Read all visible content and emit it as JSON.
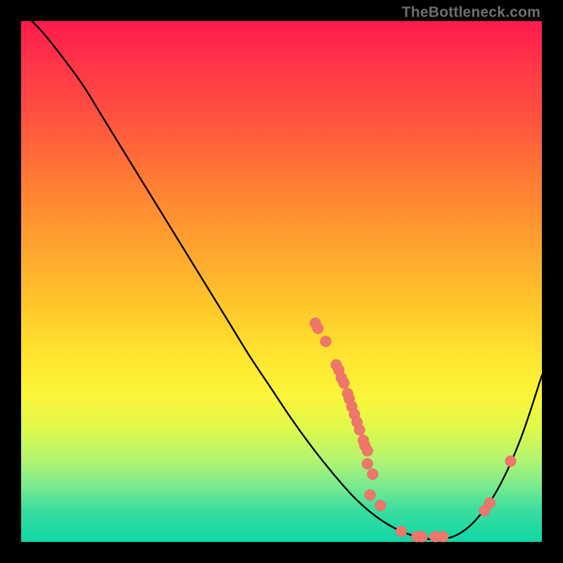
{
  "watermark": "TheBottleneck.com",
  "colors": {
    "dot": "#ee766b",
    "curve": "#000000"
  },
  "chart_data": {
    "type": "line",
    "title": "",
    "xlabel": "",
    "ylabel": "",
    "xlim": [
      0,
      100
    ],
    "ylim": [
      0,
      100
    ],
    "grid": false,
    "legend": false,
    "series": [
      {
        "name": "curve",
        "x": [
          0,
          4,
          8,
          12,
          16,
          20,
          24,
          28,
          32,
          36,
          40,
          44,
          48,
          52,
          56,
          60,
          64,
          68,
          72,
          76,
          80,
          84,
          88,
          92,
          96,
          100
        ],
        "y": [
          102,
          98,
          93,
          87.5,
          81,
          74.5,
          68,
          61.5,
          55,
          48.5,
          42,
          35.5,
          29.5,
          23.5,
          18,
          13,
          8.5,
          5,
          2.5,
          1,
          0.5,
          1.5,
          5,
          11,
          20,
          32
        ]
      }
    ],
    "points": [
      {
        "name": "p1",
        "x": 56.5,
        "y": 42.0
      },
      {
        "name": "p2",
        "x": 57.0,
        "y": 41.0
      },
      {
        "name": "p3",
        "x": 58.5,
        "y": 38.5
      },
      {
        "name": "p4",
        "x": 60.5,
        "y": 34.0
      },
      {
        "name": "p5",
        "x": 61.0,
        "y": 33.0
      },
      {
        "name": "p6",
        "x": 61.5,
        "y": 31.5
      },
      {
        "name": "p7",
        "x": 62.0,
        "y": 30.5
      },
      {
        "name": "p8",
        "x": 62.7,
        "y": 28.5
      },
      {
        "name": "p9",
        "x": 63.0,
        "y": 27.5
      },
      {
        "name": "p10",
        "x": 63.5,
        "y": 26.0
      },
      {
        "name": "p11",
        "x": 64.0,
        "y": 24.5
      },
      {
        "name": "p12",
        "x": 64.5,
        "y": 23.0
      },
      {
        "name": "p13",
        "x": 65.0,
        "y": 21.5
      },
      {
        "name": "p14",
        "x": 65.7,
        "y": 19.5
      },
      {
        "name": "p15",
        "x": 66.0,
        "y": 18.5
      },
      {
        "name": "p16",
        "x": 66.5,
        "y": 17.5
      },
      {
        "name": "p17",
        "x": 66.5,
        "y": 15.0
      },
      {
        "name": "p18",
        "x": 67.5,
        "y": 13.0
      },
      {
        "name": "p19",
        "x": 67.0,
        "y": 9.0
      },
      {
        "name": "p20",
        "x": 69.0,
        "y": 7.0
      },
      {
        "name": "p21",
        "x": 73.0,
        "y": 2.0
      },
      {
        "name": "p22",
        "x": 76.0,
        "y": 1.0
      },
      {
        "name": "p23",
        "x": 77.0,
        "y": 1.0
      },
      {
        "name": "p24",
        "x": 79.5,
        "y": 1.0
      },
      {
        "name": "p25",
        "x": 81.0,
        "y": 1.0
      },
      {
        "name": "p26",
        "x": 89.0,
        "y": 6.0
      },
      {
        "name": "p27",
        "x": 90.0,
        "y": 7.5
      },
      {
        "name": "p28",
        "x": 94.0,
        "y": 15.5
      }
    ]
  }
}
